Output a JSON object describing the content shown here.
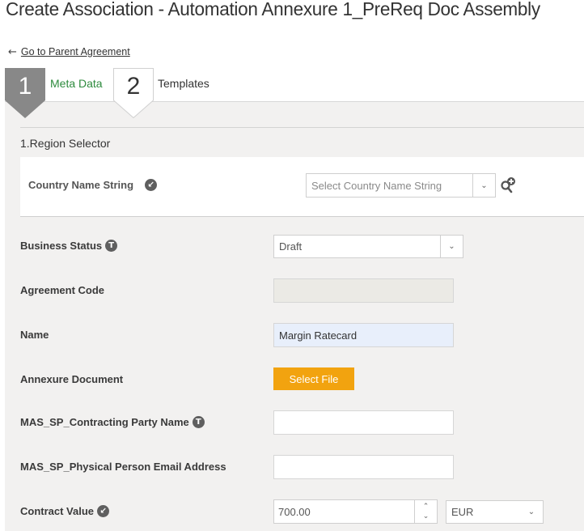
{
  "header": {
    "title": "Create Association - Automation Annexure 1_PreReq Doc Assembly",
    "back_link": "Go to Parent Agreement",
    "back_icon": "arrow-left-icon"
  },
  "steps": [
    {
      "number": "1",
      "label": "Meta Data",
      "active": true
    },
    {
      "number": "2",
      "label": "Templates",
      "active": false
    }
  ],
  "section": {
    "title": "1.Region Selector",
    "country": {
      "label": "Country Name String",
      "icon": "lookup-arrow-icon",
      "placeholder": "Select Country Name String",
      "caret": "⌄",
      "lookup_icon": "search-plus-icon"
    }
  },
  "fields": {
    "business_status": {
      "label": "Business Status",
      "icon": "T",
      "value": "Draft",
      "caret": "⌄"
    },
    "agreement_code": {
      "label": "Agreement Code",
      "value": ""
    },
    "name": {
      "label": "Name",
      "value": "Margin Ratecard"
    },
    "annexure_document": {
      "label": "Annexure Document",
      "button": "Select File"
    },
    "contracting_party": {
      "label": "MAS_SP_Contracting Party Name",
      "icon": "T",
      "value": ""
    },
    "email": {
      "label": "MAS_SP_Physical Person Email Address",
      "value": ""
    },
    "contract_value": {
      "label": "Contract Value",
      "icon": "lookup-arrow-icon",
      "value": "700.00",
      "spin_up": "⌃",
      "spin_down": "⌄",
      "currency": "EUR",
      "caret": "⌄"
    }
  },
  "colors": {
    "accent_green": "#2e8b3e",
    "button_orange": "#f2a30f",
    "active_step": "#888888",
    "panel_bg": "#f2f1f0"
  }
}
